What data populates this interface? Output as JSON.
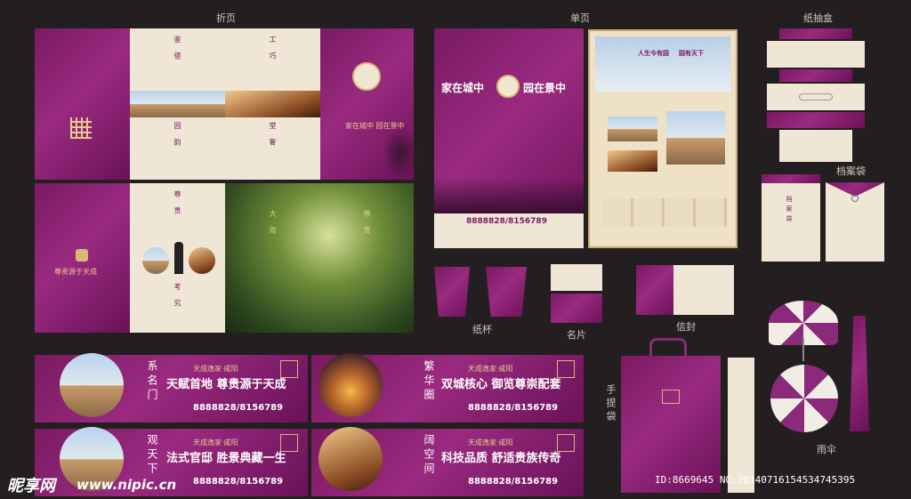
{
  "labels": {
    "zheye": "折页",
    "danye": "单页",
    "zhichouhe": "纸抽盒",
    "danganai": "档案袋",
    "zhibei": "纸杯",
    "mingpian": "名片",
    "xinfeng": "信封",
    "shoutidai": "手提袋",
    "yusan": "雨伞"
  },
  "flyer": {
    "headline_left": "家在城中",
    "headline_right": "园在景中",
    "phone": "8888828/8156789"
  },
  "brochure": {
    "sec1": "鉴 德",
    "sec2": "工 巧",
    "sec3": "园 韵",
    "sec4": "堂 奢",
    "sec5": "尊 贵",
    "sec6": "考 究",
    "sec7": "大 观",
    "sec8": "尊 贵",
    "tagline": "尊贵源于天成",
    "cover_line": "家在城中  园在景中"
  },
  "banners": [
    {
      "vertical": "系名门",
      "title": "天赋首地  尊贵源于天成",
      "brand": "天成逸家·咸阳",
      "phone": "8888828/8156789"
    },
    {
      "vertical": "繁华圈",
      "title": "双城核心  御览尊崇配套",
      "brand": "天成逸家·咸阳",
      "phone": "8888828/8156789"
    },
    {
      "vertical": "观天下",
      "title": "法式官邸  胜景典藏一生",
      "brand": "天成逸家·咸阳",
      "phone": "8888828/8156789"
    },
    {
      "vertical": "阔空间",
      "title": "科技品质  舒适贵族传奇",
      "brand": "天成逸家·咸阳",
      "phone": "8888828/8156789"
    }
  ],
  "single_page": {
    "title_left": "人生今有园",
    "title_right": "园有天下"
  },
  "folder": {
    "title": "档案袋"
  },
  "watermark": {
    "logo": "昵享网",
    "url": "www.nipic.cn",
    "id": "ID:8669645 NO:20140716154534745395"
  }
}
